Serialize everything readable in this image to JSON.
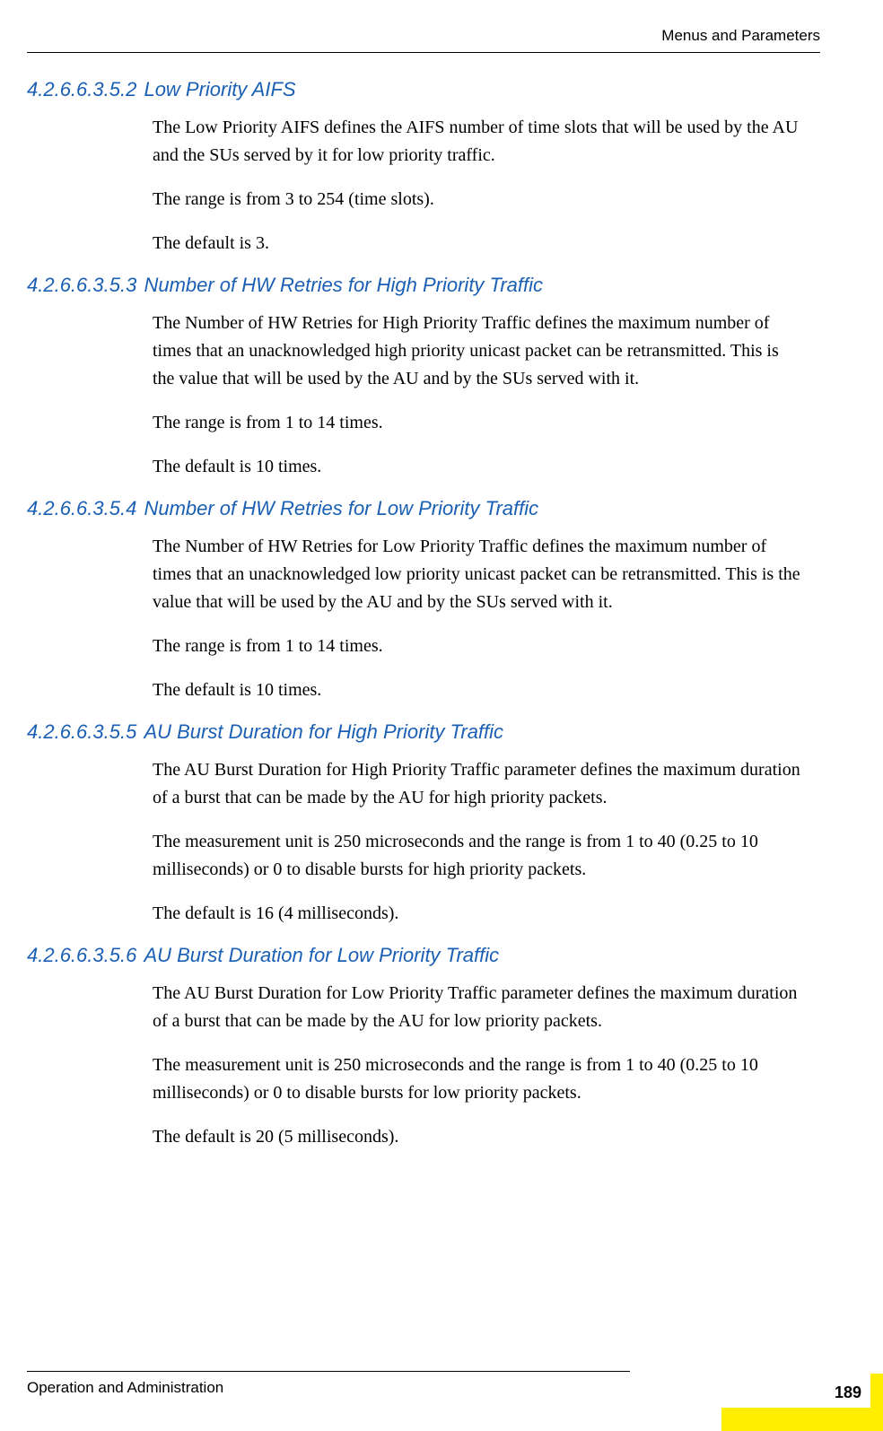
{
  "header": {
    "chapter_title": "Menus and Parameters"
  },
  "sections": [
    {
      "number": "4.2.6.6.3.5.2",
      "title": "Low Priority AIFS",
      "paragraphs": [
        "The Low Priority AIFS defines the AIFS number of time slots that will be used by the AU and the SUs served by it for low priority traffic.",
        "The range is from 3 to 254 (time slots).",
        "The default is 3."
      ]
    },
    {
      "number": "4.2.6.6.3.5.3",
      "title": "Number of HW Retries for High Priority Traffic",
      "paragraphs": [
        "The Number of HW Retries for High Priority Traffic defines the maximum number of times that an unacknowledged high priority unicast packet can be retransmitted. This is the value that will be used by the AU and by the SUs served with it.",
        "The range is from 1 to 14 times.",
        "The default is 10 times."
      ]
    },
    {
      "number": "4.2.6.6.3.5.4",
      "title": "Number of HW Retries for Low Priority Traffic",
      "paragraphs": [
        "The Number of HW Retries for Low Priority Traffic defines the maximum number of times that an unacknowledged low priority unicast packet can be retransmitted. This is the value that will be used by the AU and by the SUs served with it.",
        "The range is from 1 to 14 times.",
        "The default is 10 times."
      ]
    },
    {
      "number": "4.2.6.6.3.5.5",
      "title": "AU Burst Duration for High Priority Traffic",
      "paragraphs": [
        "The AU Burst Duration for High Priority Traffic parameter defines the maximum duration of a burst that can be made by the AU for high priority packets.",
        "The measurement unit is 250 microseconds and the range is from 1 to 40 (0.25 to 10 milliseconds) or 0 to disable bursts for high priority packets.",
        "The default is 16 (4 milliseconds)."
      ]
    },
    {
      "number": "4.2.6.6.3.5.6",
      "title": "AU Burst Duration for Low Priority Traffic",
      "paragraphs": [
        "The AU Burst Duration for Low Priority Traffic parameter defines the maximum duration of a burst that can be made by the AU for low priority packets.",
        "The measurement unit is 250 microseconds and the range is from 1 to 40 (0.25 to 10 milliseconds) or 0 to disable bursts for low priority packets.",
        "The default is 20 (5 milliseconds)."
      ]
    }
  ],
  "footer": {
    "doc_title": "Operation and Administration",
    "page_number": "189"
  }
}
